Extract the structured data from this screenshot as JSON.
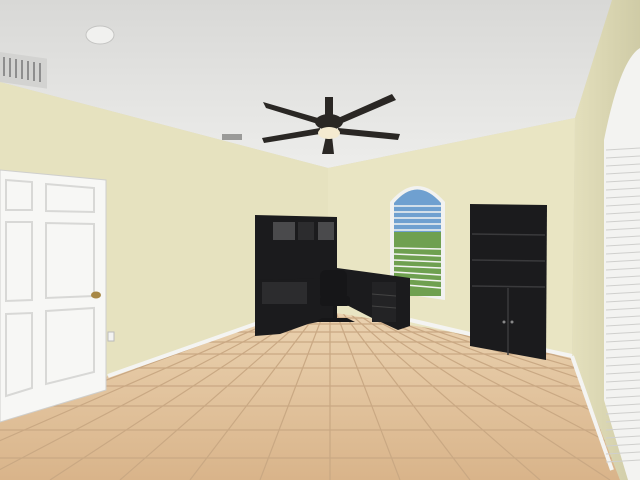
{
  "scene": {
    "description_type": "room-photo",
    "colors": {
      "ceiling": "#e8e8e6",
      "wall_left": "#e6e2bf",
      "wall_back": "#e9e5c3",
      "wall_right": "#dedbb6",
      "floor_tile": "#e6c6a0",
      "floor_grout": "#c8a880",
      "furniture": "#1b1b1d",
      "door": "#f7f7f5",
      "trim": "#f4f4f2",
      "fan": "#2a2724",
      "sky": "#6fa0d0",
      "grass": "#6fa050"
    }
  }
}
